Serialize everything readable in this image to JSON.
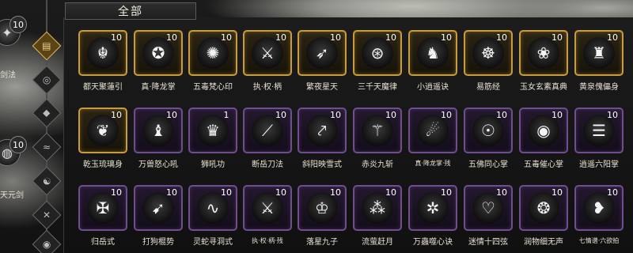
{
  "header": {
    "title": "全部"
  },
  "sidebar": {
    "equipped": [
      {
        "name": "剑法",
        "level": "10",
        "icon": "sword-flurry-icon"
      },
      {
        "name": "天元剑",
        "level": "10",
        "icon": "sword-ring-icon"
      }
    ],
    "categories": [
      {
        "icon": "book-icon",
        "glyph": "▤",
        "active": true
      },
      {
        "icon": "palm-icon",
        "glyph": "◎",
        "active": false
      },
      {
        "icon": "diamond-icon",
        "glyph": "◆",
        "active": false
      },
      {
        "icon": "claw-icon",
        "glyph": "≈",
        "active": false
      },
      {
        "icon": "swirl-icon",
        "glyph": "☯",
        "active": false
      },
      {
        "icon": "blade-icon",
        "glyph": "✕",
        "active": false
      },
      {
        "icon": "eye-icon",
        "glyph": "◉",
        "active": false
      }
    ]
  },
  "skills": [
    {
      "name": "都天聚蓮引",
      "level": "10",
      "rarity": "gold",
      "icon": "demon-mask-icon",
      "glyph": "☬"
    },
    {
      "name": "真·降龙掌",
      "level": "10",
      "rarity": "gold",
      "icon": "dragon-palm-icon",
      "glyph": "✪"
    },
    {
      "name": "五毒梵心印",
      "level": "10",
      "rarity": "gold",
      "icon": "vortex-icon",
      "glyph": "✺"
    },
    {
      "name": "执·权·柄",
      "level": "10",
      "rarity": "gold",
      "icon": "crossed-blades-icon",
      "glyph": "⚔"
    },
    {
      "name": "繁夜星天",
      "level": "10",
      "rarity": "gold",
      "icon": "arrows-icon",
      "glyph": "➶"
    },
    {
      "name": "三千天魔律",
      "level": "10",
      "rarity": "gold",
      "icon": "spiral-orb-icon",
      "glyph": "⊛"
    },
    {
      "name": "小逍遥诀",
      "level": "10",
      "rarity": "gold",
      "icon": "wolf-head-icon",
      "glyph": "♞"
    },
    {
      "name": "易筋经",
      "level": "10",
      "rarity": "gold",
      "icon": "meditation-icon",
      "glyph": "☸"
    },
    {
      "name": "玉女玄素真典",
      "level": "10",
      "rarity": "gold",
      "icon": "serpent-icon",
      "glyph": "❀"
    },
    {
      "name": "黄泉傀儡身",
      "level": "10",
      "rarity": "gold",
      "icon": "golem-icon",
      "glyph": "♜"
    },
    {
      "name": "乾玉琉璃身",
      "level": "10",
      "rarity": "gold",
      "icon": "phoenix-icon",
      "glyph": "❦"
    },
    {
      "name": "万兽怒心吼",
      "level": "10",
      "rarity": "purple",
      "icon": "beast-roar-icon",
      "glyph": "♝"
    },
    {
      "name": "狮吼功",
      "level": "1",
      "rarity": "purple",
      "icon": "lion-icon",
      "glyph": "♛"
    },
    {
      "name": "断岳刀法",
      "level": "10",
      "rarity": "purple",
      "icon": "slash-icon",
      "glyph": "⟋"
    },
    {
      "name": "斜阳映雪式",
      "level": "10",
      "rarity": "purple",
      "icon": "sword-strike-icon",
      "glyph": "⤤"
    },
    {
      "name": "赤炎九斩",
      "level": "10",
      "rarity": "purple",
      "icon": "flame-sword-icon",
      "glyph": "⚚"
    },
    {
      "name": "真·降龙掌·残",
      "level": "10",
      "rarity": "purple",
      "icon": "fire-palm-icon",
      "glyph": "☄"
    },
    {
      "name": "五佛同心掌",
      "level": "10",
      "rarity": "purple",
      "icon": "buddha-halo-icon",
      "glyph": "☉"
    },
    {
      "name": "五毒催心掌",
      "level": "10",
      "rarity": "purple",
      "icon": "eye-ring-icon",
      "glyph": "◉"
    },
    {
      "name": "逍遥六阳掌",
      "level": "10",
      "rarity": "purple",
      "icon": "bagua-icon",
      "glyph": "☰"
    },
    {
      "name": "归岳式",
      "level": "10",
      "rarity": "purple",
      "icon": "sword-pair-icon",
      "glyph": "✠"
    },
    {
      "name": "打狗棍势",
      "level": "10",
      "rarity": "purple",
      "icon": "staff-swing-icon",
      "glyph": "➹"
    },
    {
      "name": "灵蛇寻洞式",
      "level": "10",
      "rarity": "purple",
      "icon": "snake-coil-icon",
      "glyph": "∿"
    },
    {
      "name": "执·权·柄·残",
      "level": "10",
      "rarity": "purple",
      "icon": "crossed-blades-icon",
      "glyph": "⚔"
    },
    {
      "name": "落星九子",
      "level": "10",
      "rarity": "purple",
      "icon": "star-crown-icon",
      "glyph": "♔"
    },
    {
      "name": "流萤赶月",
      "level": "10",
      "rarity": "purple",
      "icon": "fireflies-icon",
      "glyph": "⁂"
    },
    {
      "name": "万蟲噬心诀",
      "level": "10",
      "rarity": "purple",
      "icon": "spider-icon",
      "glyph": "✲"
    },
    {
      "name": "迷情十四弦",
      "level": "10",
      "rarity": "purple",
      "icon": "heart-strings-icon",
      "glyph": "♡"
    },
    {
      "name": "润物细无声",
      "level": "10",
      "rarity": "purple",
      "icon": "rain-swirl-icon",
      "glyph": "❂"
    },
    {
      "name": "七情谱·六欲拍",
      "level": "10",
      "rarity": "purple",
      "icon": "heart-wave-icon",
      "glyph": "❥"
    }
  ]
}
